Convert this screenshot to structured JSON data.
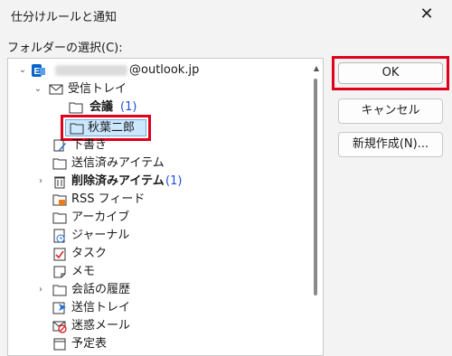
{
  "window": {
    "title": "仕分けルールと通知",
    "close_glyph": "✕"
  },
  "folder_label": "フォルダーの選択(C):",
  "tree": {
    "account": {
      "email": "@outlook.jp"
    },
    "inbox": {
      "label": "受信トレイ"
    },
    "meeting": {
      "label": "会議",
      "count": "(1)"
    },
    "akiba": {
      "label": "秋葉二郎"
    },
    "drafts": {
      "label": "下書き"
    },
    "sent": {
      "label": "送信済みアイテム"
    },
    "deleted": {
      "label": "削除済みアイテム",
      "count": "(1)"
    },
    "rss": {
      "label": "RSS フィード"
    },
    "archive": {
      "label": "アーカイブ"
    },
    "journal": {
      "label": "ジャーナル"
    },
    "tasks": {
      "label": "タスク"
    },
    "notes": {
      "label": "メモ"
    },
    "history": {
      "label": "会話の履歴"
    },
    "outbox": {
      "label": "送信トレイ"
    },
    "junk": {
      "label": "迷惑メール"
    },
    "calendar": {
      "label": "予定表"
    }
  },
  "buttons": {
    "ok": "OK",
    "cancel": "キャンセル",
    "new": "新規作成(N)..."
  },
  "colors": {
    "highlight": "#e0001a",
    "selection": "#cce8ff",
    "count": "#1f4fd8"
  }
}
